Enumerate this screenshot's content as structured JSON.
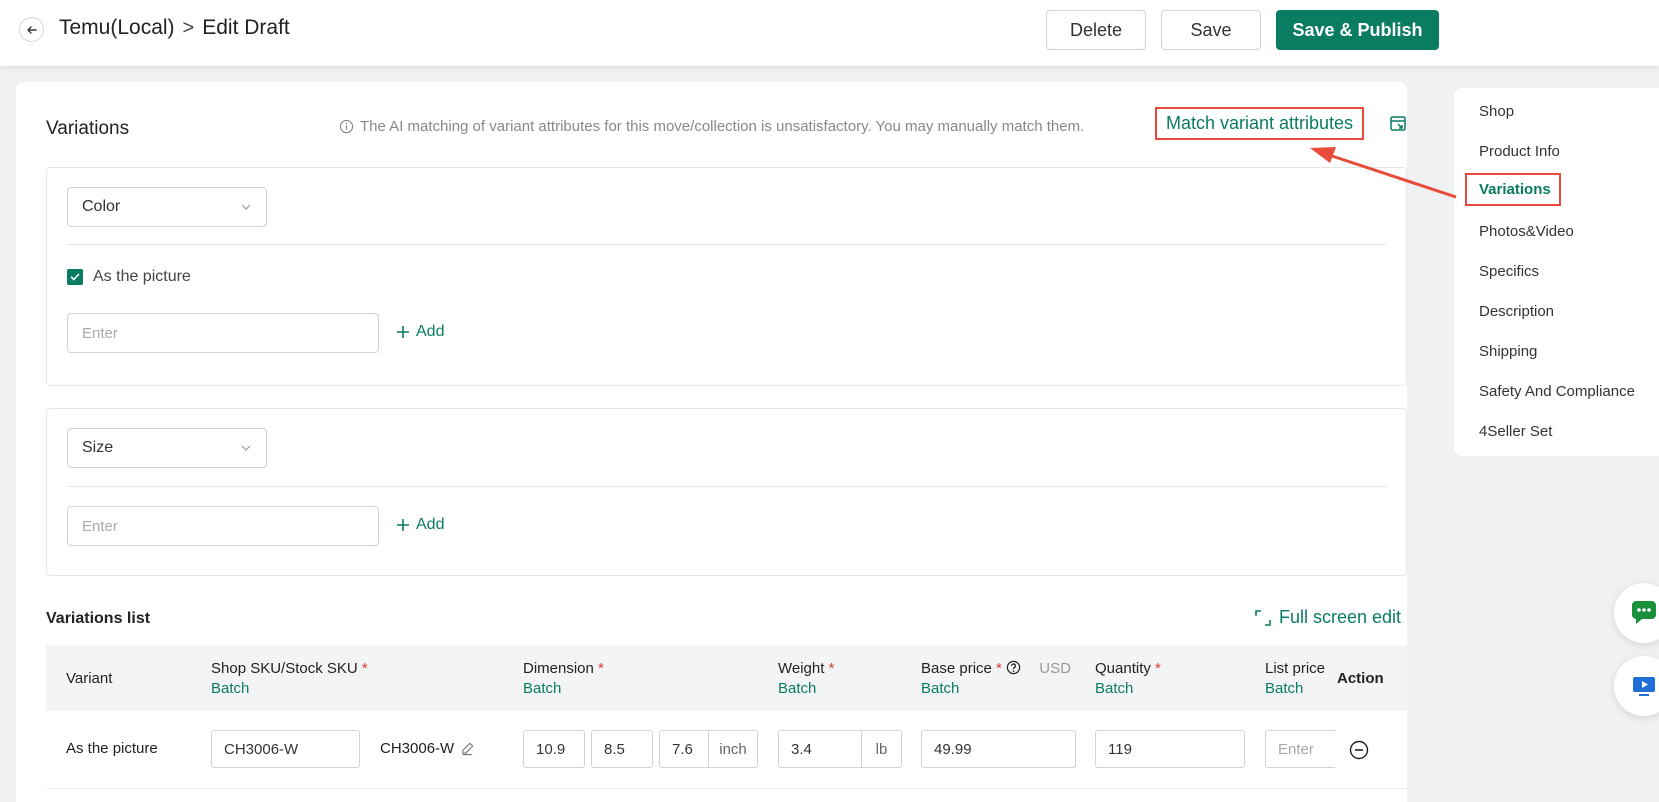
{
  "header": {
    "breadcrumb_root": "Temu(Local)",
    "breadcrumb_sep": ">",
    "breadcrumb_current": "Edit Draft",
    "delete_label": "Delete",
    "save_label": "Save",
    "publish_label": "Save & Publish"
  },
  "variations": {
    "title": "Variations",
    "notice": "The AI matching of variant attributes for this move/collection is unsatisfactory. You may manually match them.",
    "match_link": "Match variant attributes",
    "color_attr": {
      "select_value": "Color",
      "checkbox_label": "As the picture",
      "checkbox_checked": true,
      "input_placeholder": "Enter",
      "add_label": "Add"
    },
    "size_attr": {
      "select_value": "Size",
      "input_placeholder": "Enter",
      "add_label": "Add"
    }
  },
  "variations_list": {
    "title": "Variations list",
    "fullscreen_label": "Full screen edit",
    "columns": {
      "variant": "Variant",
      "sku": "Shop SKU/Stock SKU",
      "dimension": "Dimension",
      "weight": "Weight",
      "base_price": "Base price",
      "currency": "USD",
      "quantity": "Quantity",
      "list_price": "List price",
      "action": "Action",
      "batch": "Batch",
      "required_mark": "*"
    },
    "rows": [
      {
        "variant": "As the picture",
        "shop_sku": "CH3006-W",
        "stock_sku": "CH3006-W",
        "dim_length": "10.9",
        "dim_width": "8.5",
        "dim_height": "7.6",
        "dim_unit": "inch",
        "weight": "3.4",
        "weight_unit": "lb",
        "base_price": "49.99",
        "quantity": "119",
        "list_price_placeholder": "Enter"
      }
    ]
  },
  "right_nav": {
    "items": [
      "Shop",
      "Product Info",
      "Variations",
      "Photos&Video",
      "Specifics",
      "Description",
      "Shipping",
      "Safety And Compliance",
      "4Seller Set"
    ],
    "active": "Variations"
  },
  "colors": {
    "brand": "#0a7c62",
    "highlight": "#e84b3c",
    "required": "#e03a2e"
  }
}
